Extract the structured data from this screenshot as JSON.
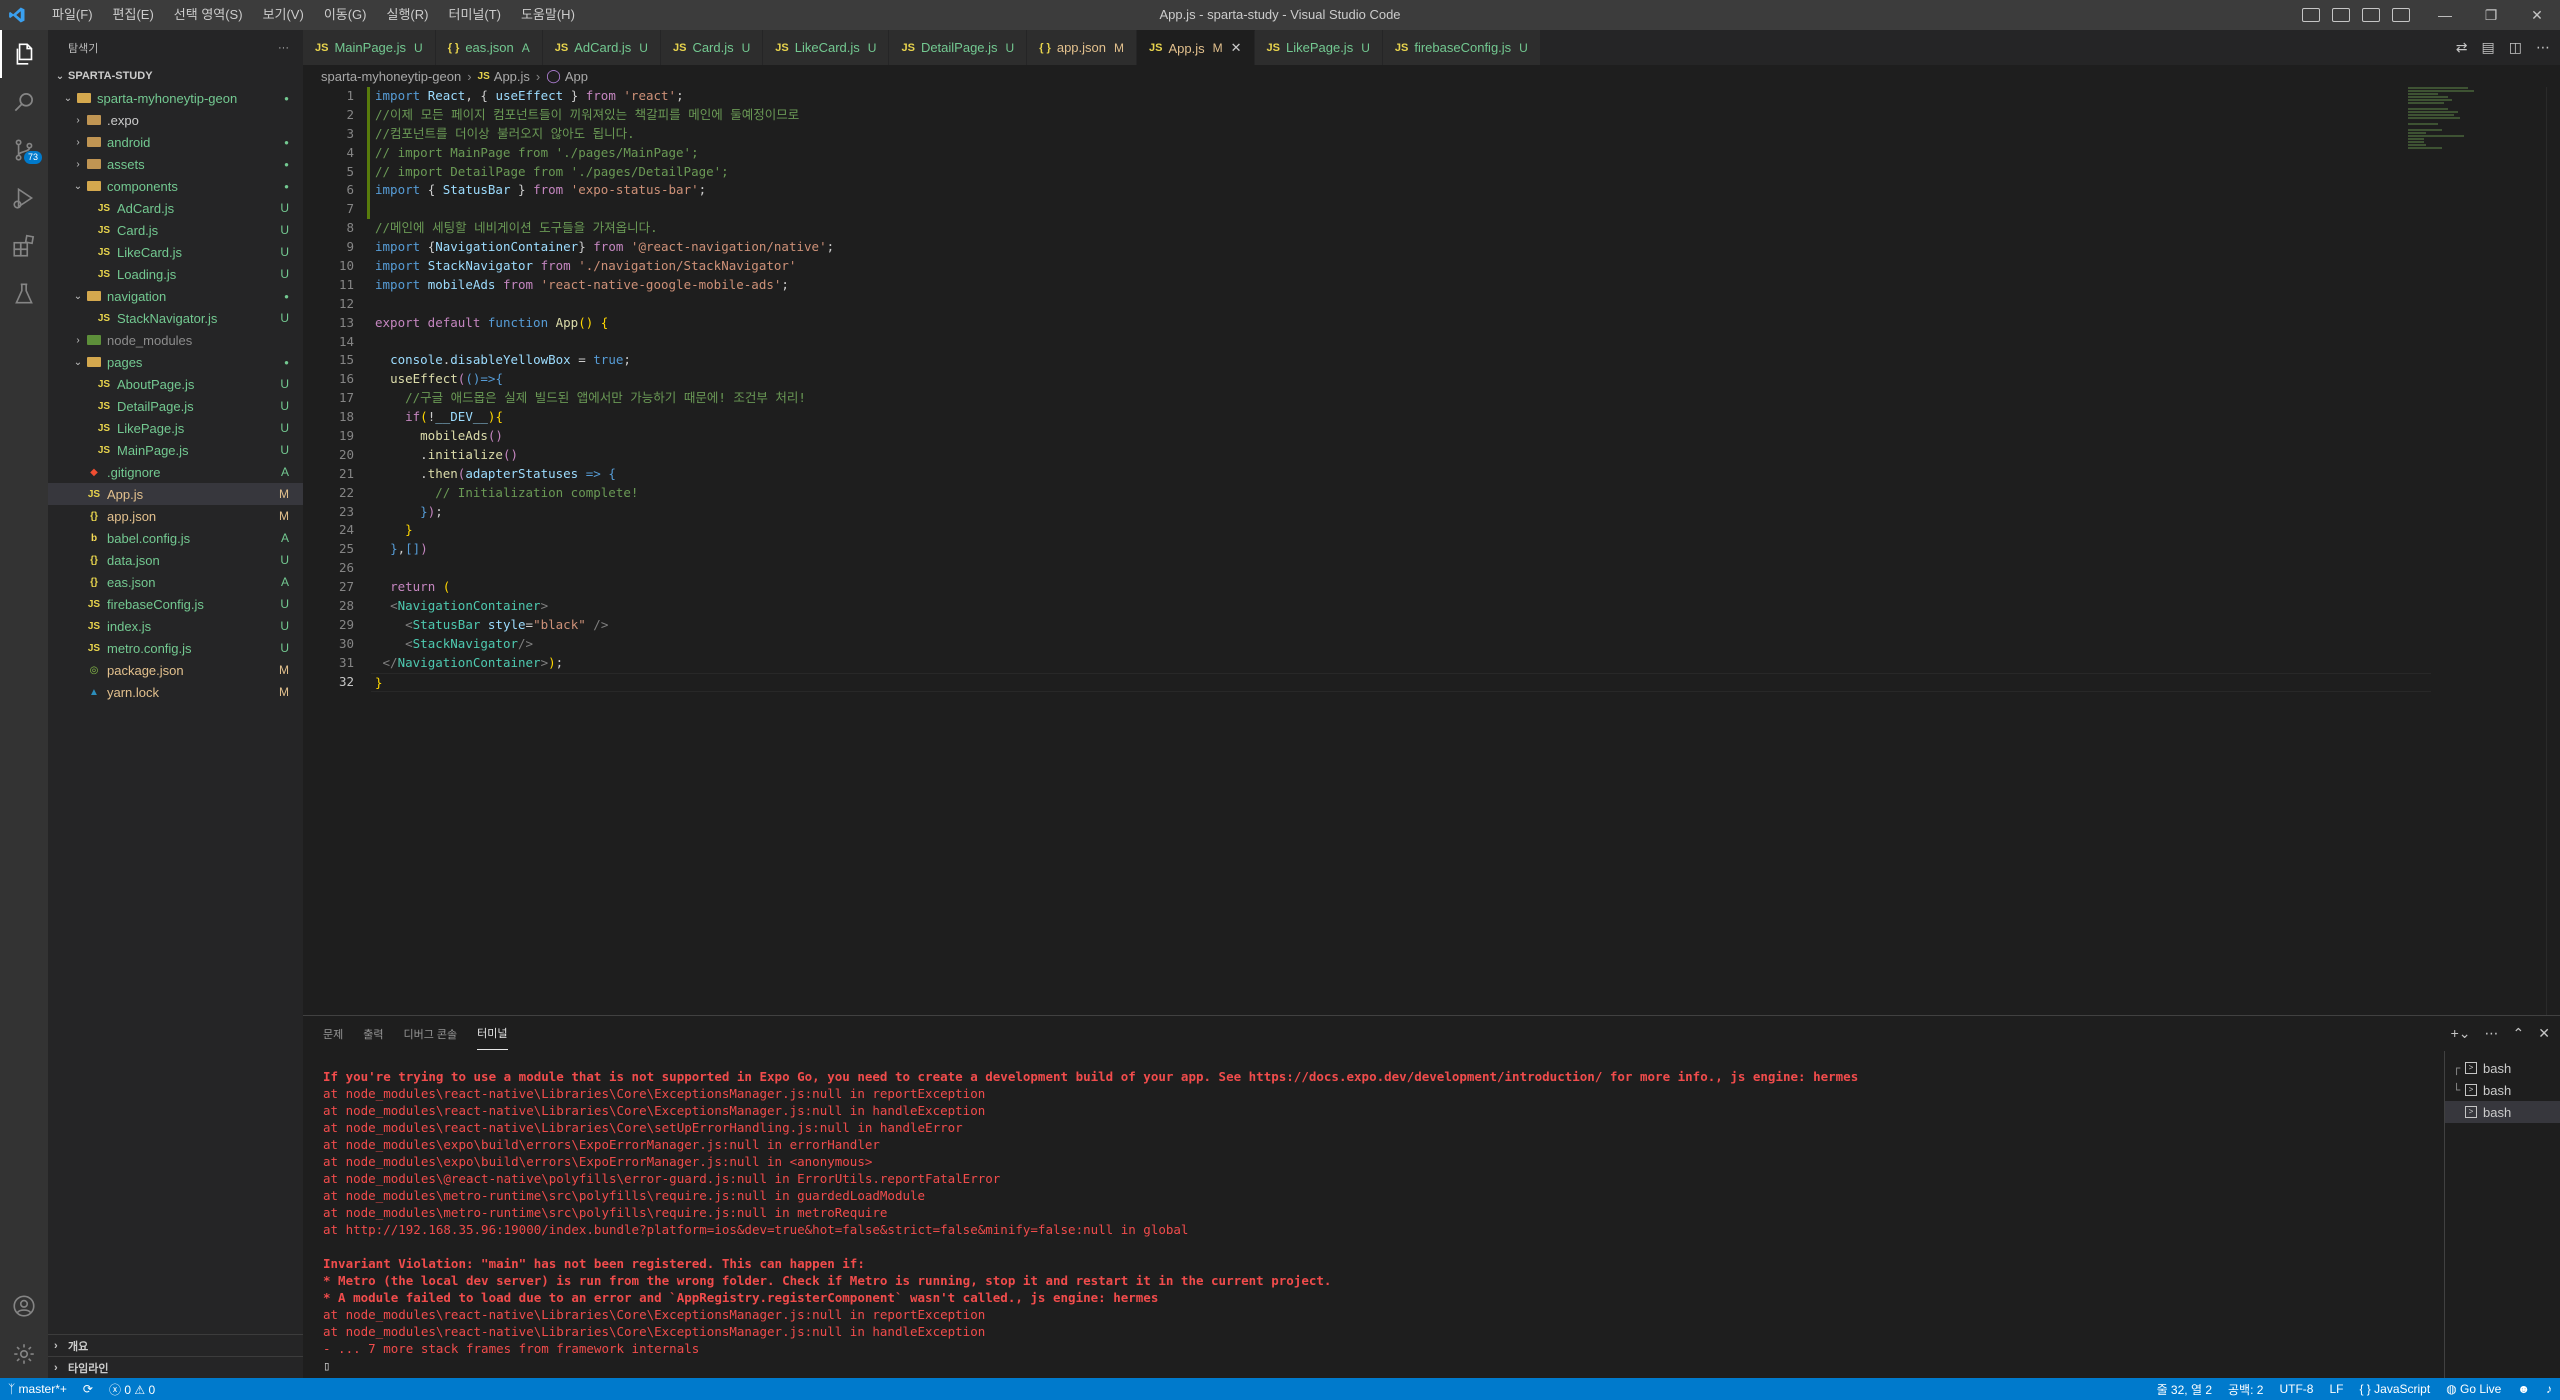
{
  "menu": [
    "파일(F)",
    "편집(E)",
    "선택 영역(S)",
    "보기(V)",
    "이동(G)",
    "실행(R)",
    "터미널(T)",
    "도움말(H)"
  ],
  "window_title": "App.js - sparta-study - Visual Studio Code",
  "activity_badge": "73",
  "explorer": {
    "header": "탐색기",
    "more": "···",
    "root": "SPARTA-STUDY",
    "items": [
      {
        "depth": 0,
        "type": "folder",
        "open": true,
        "name": "sparta-myhoneytip-geon",
        "status": "●",
        "color": "#73c991"
      },
      {
        "depth": 1,
        "type": "folder",
        "open": false,
        "name": ".expo",
        "status": "",
        "color": "#cccccc"
      },
      {
        "depth": 1,
        "type": "folder",
        "open": false,
        "name": "android",
        "status": "●",
        "color": "#73c991"
      },
      {
        "depth": 1,
        "type": "folder",
        "open": false,
        "name": "assets",
        "status": "●",
        "color": "#73c991"
      },
      {
        "depth": 1,
        "type": "folder",
        "open": true,
        "name": "components",
        "status": "●",
        "color": "#73c991"
      },
      {
        "depth": 2,
        "type": "js",
        "name": "AdCard.js",
        "status": "U",
        "color": "#73c991"
      },
      {
        "depth": 2,
        "type": "js",
        "name": "Card.js",
        "status": "U",
        "color": "#73c991"
      },
      {
        "depth": 2,
        "type": "js",
        "name": "LikeCard.js",
        "status": "U",
        "color": "#73c991"
      },
      {
        "depth": 2,
        "type": "js",
        "name": "Loading.js",
        "status": "U",
        "color": "#73c991"
      },
      {
        "depth": 1,
        "type": "folder",
        "open": true,
        "name": "navigation",
        "status": "●",
        "color": "#73c991"
      },
      {
        "depth": 2,
        "type": "js",
        "name": "StackNavigator.js",
        "status": "U",
        "color": "#73c991"
      },
      {
        "depth": 1,
        "type": "folder",
        "open": false,
        "name": "node_modules",
        "status": "",
        "color": "#8c8c8c"
      },
      {
        "depth": 1,
        "type": "folder",
        "open": true,
        "name": "pages",
        "status": "●",
        "color": "#73c991"
      },
      {
        "depth": 2,
        "type": "js",
        "name": "AboutPage.js",
        "status": "U",
        "color": "#73c991"
      },
      {
        "depth": 2,
        "type": "js",
        "name": "DetailPage.js",
        "status": "U",
        "color": "#73c991"
      },
      {
        "depth": 2,
        "type": "js",
        "name": "LikePage.js",
        "status": "U",
        "color": "#73c991"
      },
      {
        "depth": 2,
        "type": "js",
        "name": "MainPage.js",
        "status": "U",
        "color": "#73c991"
      },
      {
        "depth": 1,
        "type": "git",
        "name": ".gitignore",
        "status": "A",
        "color": "#73c991"
      },
      {
        "depth": 1,
        "type": "js",
        "name": "App.js",
        "status": "M",
        "color": "#e2c08d",
        "selected": true
      },
      {
        "depth": 1,
        "type": "json",
        "name": "app.json",
        "status": "M",
        "color": "#e2c08d"
      },
      {
        "depth": 1,
        "type": "babel",
        "name": "babel.config.js",
        "status": "A",
        "color": "#73c991"
      },
      {
        "depth": 1,
        "type": "json",
        "name": "data.json",
        "status": "U",
        "color": "#73c991"
      },
      {
        "depth": 1,
        "type": "json",
        "name": "eas.json",
        "status": "A",
        "color": "#73c991"
      },
      {
        "depth": 1,
        "type": "js",
        "name": "firebaseConfig.js",
        "status": "U",
        "color": "#73c991"
      },
      {
        "depth": 1,
        "type": "js",
        "name": "index.js",
        "status": "U",
        "color": "#73c991"
      },
      {
        "depth": 1,
        "type": "js",
        "name": "metro.config.js",
        "status": "U",
        "color": "#73c991"
      },
      {
        "depth": 1,
        "type": "npm",
        "name": "package.json",
        "status": "M",
        "color": "#e2c08d"
      },
      {
        "depth": 1,
        "type": "yarn",
        "name": "yarn.lock",
        "status": "M",
        "color": "#e2c08d"
      }
    ],
    "outline": "개요",
    "timeline": "타임라인"
  },
  "tabs": [
    {
      "icon": "JS",
      "name": "MainPage.js",
      "status": "U",
      "color": "#73c991"
    },
    {
      "icon": "{ }",
      "name": "eas.json",
      "status": "A",
      "color": "#73c991"
    },
    {
      "icon": "JS",
      "name": "AdCard.js",
      "status": "U",
      "color": "#73c991"
    },
    {
      "icon": "JS",
      "name": "Card.js",
      "status": "U",
      "color": "#73c991"
    },
    {
      "icon": "JS",
      "name": "LikeCard.js",
      "status": "U",
      "color": "#73c991"
    },
    {
      "icon": "JS",
      "name": "DetailPage.js",
      "status": "U",
      "color": "#73c991"
    },
    {
      "icon": "{ }",
      "name": "app.json",
      "status": "M",
      "color": "#e2c08d"
    },
    {
      "icon": "JS",
      "name": "App.js",
      "status": "M",
      "color": "#e2c08d",
      "active": true
    },
    {
      "icon": "JS",
      "name": "LikePage.js",
      "status": "U",
      "color": "#73c991"
    },
    {
      "icon": "JS",
      "name": "firebaseConfig.js",
      "status": "U",
      "color": "#73c991"
    }
  ],
  "breadcrumb": [
    "sparta-myhoneytip-geon",
    "App.js",
    "App"
  ],
  "code_lines": [
    [
      [
        "k",
        "import "
      ],
      [
        "v",
        "React"
      ],
      [
        "p",
        ", { "
      ],
      [
        "v",
        "useEffect"
      ],
      [
        "p",
        " } "
      ],
      [
        "kw",
        "from "
      ],
      [
        "s",
        "'react'"
      ],
      [
        "p",
        ";"
      ]
    ],
    [
      [
        "c",
        "//이제 모든 페이지 컴포넌트들이 끼워져있는 책갈피를 메인에 둘예정이므로"
      ]
    ],
    [
      [
        "c",
        "//컴포넌트를 더이상 불러오지 않아도 됩니다."
      ]
    ],
    [
      [
        "c",
        "// import MainPage from './pages/MainPage';"
      ]
    ],
    [
      [
        "c",
        "// import DetailPage from './pages/DetailPage';"
      ]
    ],
    [
      [
        "k",
        "import "
      ],
      [
        "p",
        "{ "
      ],
      [
        "v",
        "StatusBar"
      ],
      [
        "p",
        " } "
      ],
      [
        "kw",
        "from "
      ],
      [
        "s",
        "'expo-status-bar'"
      ],
      [
        "p",
        ";"
      ]
    ],
    [],
    [
      [
        "c",
        "//메인에 세팅할 네비게이션 도구들을 가져옵니다."
      ]
    ],
    [
      [
        "k",
        "import "
      ],
      [
        "p",
        "{"
      ],
      [
        "v",
        "NavigationContainer"
      ],
      [
        "p",
        "} "
      ],
      [
        "kw",
        "from "
      ],
      [
        "s",
        "'@react-navigation/native'"
      ],
      [
        "p",
        ";"
      ]
    ],
    [
      [
        "k",
        "import "
      ],
      [
        "v",
        "StackNavigator"
      ],
      [
        "kw",
        " from "
      ],
      [
        "s",
        "'./navigation/StackNavigator'"
      ]
    ],
    [
      [
        "k",
        "import "
      ],
      [
        "v",
        "mobileAds"
      ],
      [
        "kw",
        " from "
      ],
      [
        "s",
        "'react-native-google-mobile-ads'"
      ],
      [
        "p",
        ";"
      ]
    ],
    [],
    [
      [
        "kw",
        "export default "
      ],
      [
        "k",
        "function "
      ],
      [
        "f",
        "App"
      ],
      [
        "y",
        "() "
      ],
      [
        "y",
        "{"
      ]
    ],
    [],
    [
      [
        "p",
        "  "
      ],
      [
        "v",
        "console"
      ],
      [
        "p",
        "."
      ],
      [
        "v",
        "disableYellowBox"
      ],
      [
        "p",
        " = "
      ],
      [
        "k",
        "true"
      ],
      [
        "p",
        ";"
      ]
    ],
    [
      [
        "p",
        "  "
      ],
      [
        "f",
        "useEffect"
      ],
      [
        "kw",
        "("
      ],
      [
        "k",
        "()"
      ],
      [
        "k",
        "=>"
      ],
      [
        "k",
        "{"
      ]
    ],
    [
      [
        "p",
        "    "
      ],
      [
        "c",
        "//구글 애드몹은 실제 빌드된 앱에서만 가능하기 때문에! 조건부 처리!"
      ]
    ],
    [
      [
        "p",
        "    "
      ],
      [
        "kw",
        "if"
      ],
      [
        "y",
        "("
      ],
      [
        "p",
        "!"
      ],
      [
        "v",
        "__DEV__"
      ],
      [
        "y",
        "){"
      ]
    ],
    [
      [
        "p",
        "      "
      ],
      [
        "f",
        "mobileAds"
      ],
      [
        "kw",
        "()"
      ]
    ],
    [
      [
        "p",
        "      ."
      ],
      [
        "f",
        "initialize"
      ],
      [
        "kw",
        "()"
      ]
    ],
    [
      [
        "p",
        "      ."
      ],
      [
        "f",
        "then"
      ],
      [
        "kw",
        "("
      ],
      [
        "v",
        "adapterStatuses"
      ],
      [
        "k",
        " => "
      ],
      [
        "k",
        "{"
      ]
    ],
    [
      [
        "p",
        "        "
      ],
      [
        "c",
        "// Initialization complete!"
      ]
    ],
    [
      [
        "p",
        "      "
      ],
      [
        "k",
        "}"
      ],
      [
        "kw",
        ")"
      ],
      [
        "p",
        ";"
      ]
    ],
    [
      [
        "p",
        "    "
      ],
      [
        "y",
        "}"
      ]
    ],
    [
      [
        "p",
        "  "
      ],
      [
        "k",
        "}"
      ],
      [
        "p",
        ","
      ],
      [
        "k",
        "[]"
      ],
      [
        "kw",
        ")"
      ]
    ],
    [],
    [
      [
        "p",
        "  "
      ],
      [
        "kw",
        "return "
      ],
      [
        "y",
        "("
      ]
    ],
    [
      [
        "p",
        "  "
      ],
      [
        "tg",
        "<"
      ],
      [
        "t",
        "NavigationContainer"
      ],
      [
        "tg",
        ">"
      ]
    ],
    [
      [
        "p",
        "    "
      ],
      [
        "tg",
        "<"
      ],
      [
        "t",
        "StatusBar"
      ],
      [
        "p",
        " "
      ],
      [
        "v",
        "style"
      ],
      [
        "p",
        "="
      ],
      [
        "s",
        "\"black\""
      ],
      [
        "tg",
        " />"
      ]
    ],
    [
      [
        "p",
        "    "
      ],
      [
        "tg",
        "<"
      ],
      [
        "t",
        "StackNavigator"
      ],
      [
        "tg",
        "/>"
      ]
    ],
    [
      [
        "p",
        " "
      ],
      [
        "tg",
        "</"
      ],
      [
        "t",
        "NavigationContainer"
      ],
      [
        "tg",
        ">"
      ],
      [
        "y",
        ")"
      ],
      [
        "p",
        ";"
      ]
    ],
    [
      [
        "y",
        "}"
      ]
    ]
  ],
  "panel_tabs": [
    "문제",
    "출력",
    "디버그 콘솔",
    "터미널"
  ],
  "terminal_lines": [
    {
      "bold": true,
      "text": "If you're trying to use a module that is not supported in Expo Go, you need to create a development build of your app. See https://docs.expo.dev/development/introduction/ for more info., js engine: hermes"
    },
    {
      "bold": false,
      "text": "at node_modules\\react-native\\Libraries\\Core\\ExceptionsManager.js:null in reportException"
    },
    {
      "bold": false,
      "text": "at node_modules\\react-native\\Libraries\\Core\\ExceptionsManager.js:null in handleException"
    },
    {
      "bold": false,
      "text": "at node_modules\\react-native\\Libraries\\Core\\setUpErrorHandling.js:null in handleError"
    },
    {
      "bold": false,
      "text": "at node_modules\\expo\\build\\errors\\ExpoErrorManager.js:null in errorHandler"
    },
    {
      "bold": false,
      "text": "at node_modules\\expo\\build\\errors\\ExpoErrorManager.js:null in <anonymous>"
    },
    {
      "bold": false,
      "text": "at node_modules\\@react-native\\polyfills\\error-guard.js:null in ErrorUtils.reportFatalError"
    },
    {
      "bold": false,
      "text": "at node_modules\\metro-runtime\\src\\polyfills\\require.js:null in guardedLoadModule"
    },
    {
      "bold": false,
      "text": "at node_modules\\metro-runtime\\src\\polyfills\\require.js:null in metroRequire"
    },
    {
      "bold": false,
      "text": "at http://192.168.35.96:19000/index.bundle?platform=ios&dev=true&hot=false&strict=false&minify=false:null in global"
    },
    {
      "bold": false,
      "text": ""
    },
    {
      "bold": true,
      "text": "Invariant Violation: \"main\" has not been registered. This can happen if:"
    },
    {
      "bold": true,
      "text": "* Metro (the local dev server) is run from the wrong folder. Check if Metro is running, stop it and restart it in the current project."
    },
    {
      "bold": true,
      "text": "* A module failed to load due to an error and `AppRegistry.registerComponent` wasn't called., js engine: hermes"
    },
    {
      "bold": false,
      "text": "at node_modules\\react-native\\Libraries\\Core\\ExceptionsManager.js:null in reportException"
    },
    {
      "bold": false,
      "text": "at node_modules\\react-native\\Libraries\\Core\\ExceptionsManager.js:null in handleException"
    },
    {
      "bold": false,
      "text": "- ... 7 more stack frames from framework internals"
    }
  ],
  "terminal_prompt": "▯",
  "terminal_sessions": [
    {
      "tree": "┌",
      "name": "bash"
    },
    {
      "tree": "└",
      "name": "bash"
    },
    {
      "tree": "",
      "name": "bash",
      "selected": true
    }
  ],
  "status": {
    "branch": "master*+",
    "sync": "⟳",
    "errors": "0",
    "warnings": "0",
    "position": "줄 32, 열 2",
    "spaces": "공백: 2",
    "encoding": "UTF-8",
    "eol": "LF",
    "language": "JavaScript",
    "golive": "Go Live"
  },
  "colors": {
    "accent": "#007acc",
    "added": "#73c991",
    "modified": "#e2c08d",
    "error": "#f14c4c"
  }
}
